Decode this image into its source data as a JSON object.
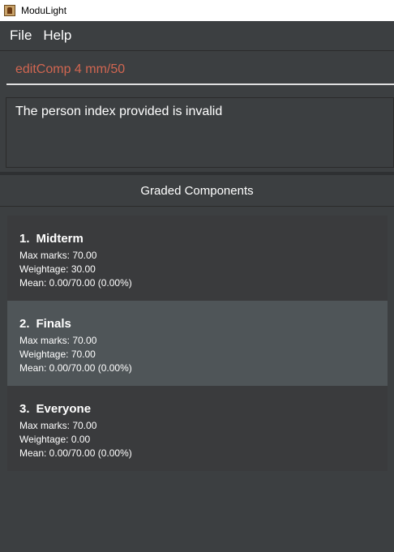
{
  "window": {
    "title": "ModuLight"
  },
  "menu": {
    "file": "File",
    "help": "Help"
  },
  "command": {
    "value": "editComp 4 mm/50"
  },
  "result": {
    "message": "The person index provided is invalid"
  },
  "panel": {
    "title": "Graded Components"
  },
  "components": [
    {
      "index": "1.",
      "name": "Midterm",
      "max_marks": "Max marks: 70.00",
      "weightage": "Weightage: 30.00",
      "mean": "Mean: 0.00/70.00 (0.00%)"
    },
    {
      "index": "2.",
      "name": "Finals",
      "max_marks": "Max marks: 70.00",
      "weightage": "Weightage: 70.00",
      "mean": "Mean: 0.00/70.00 (0.00%)"
    },
    {
      "index": "3.",
      "name": "Everyone",
      "max_marks": "Max marks: 70.00",
      "weightage": "Weightage: 0.00",
      "mean": "Mean: 0.00/70.00 (0.00%)"
    }
  ],
  "colors": {
    "background": "#3c3f41",
    "command_text": "#d06651",
    "selected_card": "#4f5558"
  }
}
